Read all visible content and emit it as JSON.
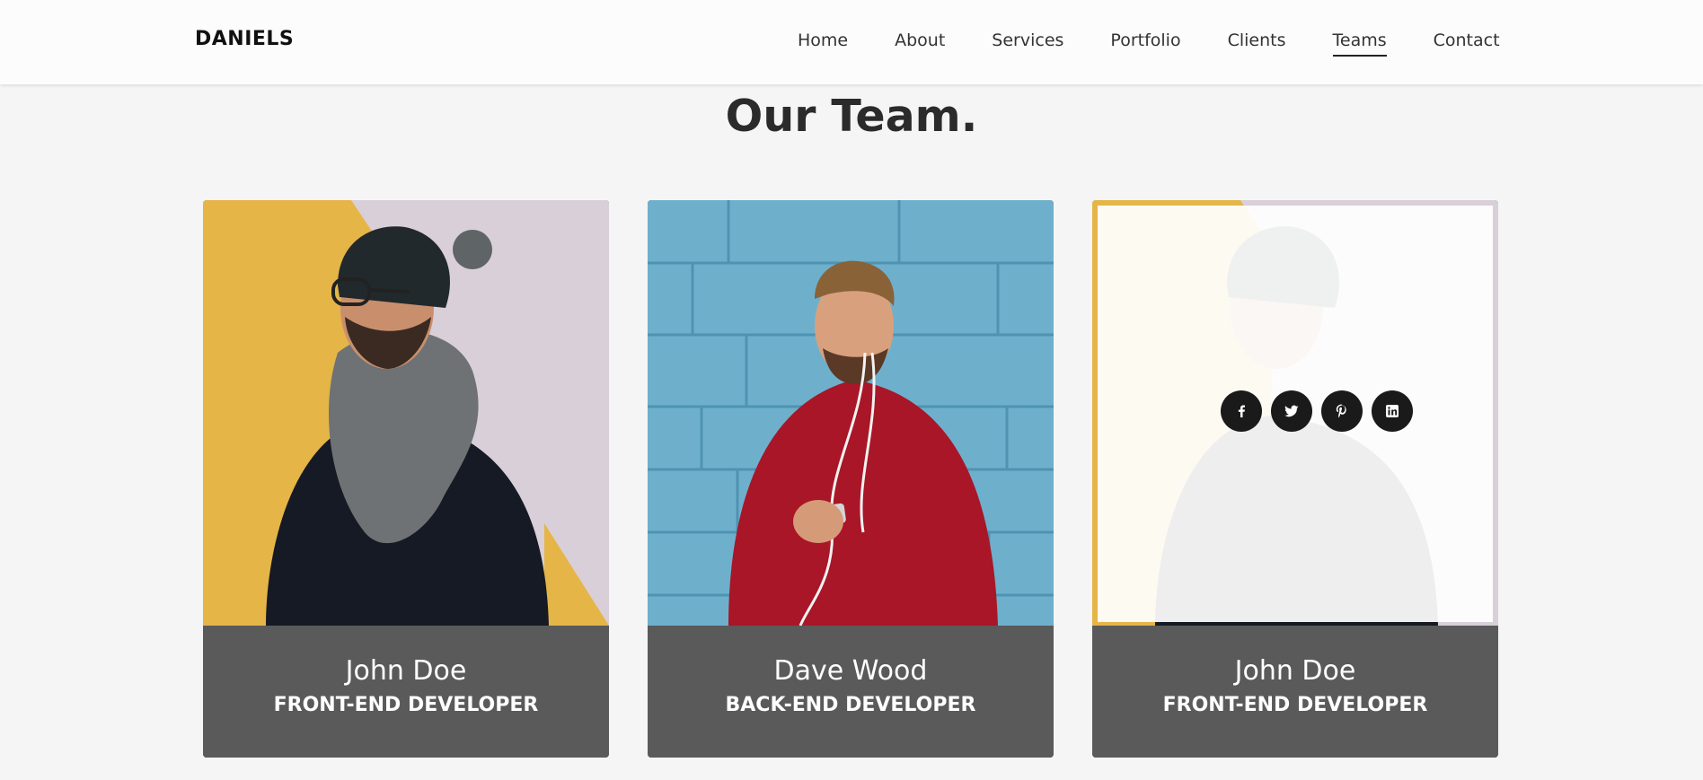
{
  "brand": {
    "name": "DANIELS"
  },
  "nav": {
    "items": [
      {
        "label": "Home"
      },
      {
        "label": "About"
      },
      {
        "label": "Services"
      },
      {
        "label": "Portfolio"
      },
      {
        "label": "Clients"
      },
      {
        "label": "Teams"
      },
      {
        "label": "Contact"
      }
    ],
    "active": "Teams"
  },
  "section": {
    "title": "Our Team."
  },
  "team": [
    {
      "name": "John Doe",
      "role": "FRONT-END DEVELOPER"
    },
    {
      "name": "Dave Wood",
      "role": "BACK-END DEVELOPER"
    },
    {
      "name": "John Doe",
      "role": "FRONT-END DEVELOPER"
    }
  ],
  "social_icons": [
    "facebook-icon",
    "twitter-icon",
    "pinterest-icon",
    "linkedin-icon"
  ],
  "colors": {
    "background": "#f5f5f5",
    "navbar": "#fcfcfc",
    "card_info": "#5a5a5a",
    "social_button": "#1a1a1a",
    "title": "#2b2b2b"
  }
}
